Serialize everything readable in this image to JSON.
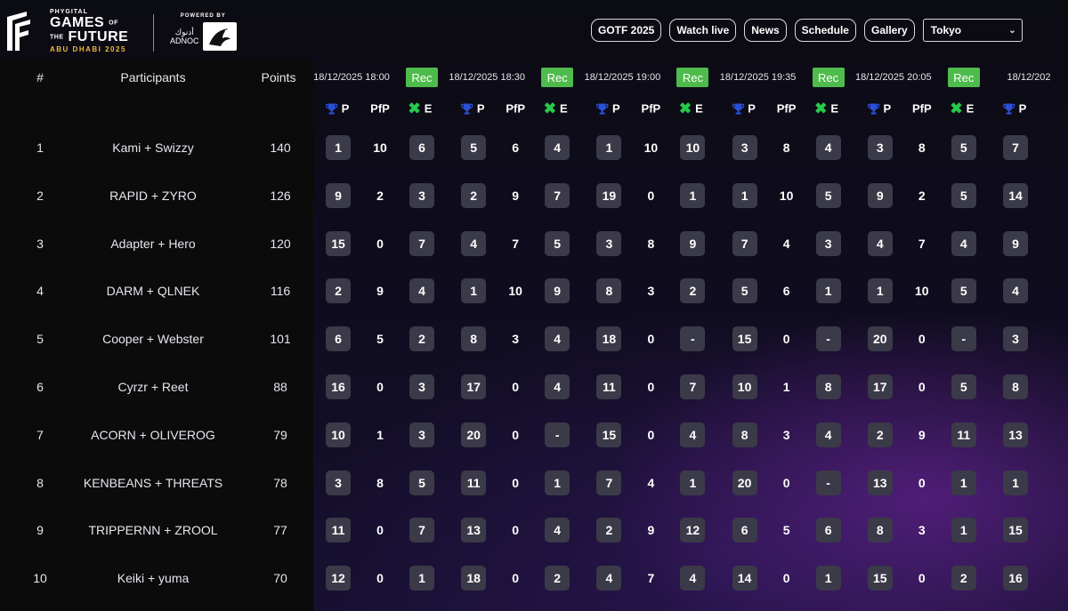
{
  "brand": {
    "phygital": "PHYGITAL",
    "games": "GAMES",
    "of": "OF",
    "the": "THE",
    "future": "FUTURE",
    "location": "ABU DHABI 2025",
    "powered_by": "POWERED BY",
    "sponsor_arabic": "أدنوك",
    "sponsor": "ADNOC"
  },
  "nav": {
    "items": [
      "GOTF 2025",
      "Watch live",
      "News",
      "Schedule",
      "Gallery"
    ],
    "timezone": "Tokyo",
    "timezone_icon": "chevron-down-icon"
  },
  "table": {
    "headers": {
      "rank": "#",
      "participants": "Participants",
      "points": "Points"
    },
    "rec_label": "Rec",
    "sub_labels": {
      "placement": "P",
      "pfp": "PfP",
      "elims": "E"
    },
    "icons": {
      "placement": "trophy-icon",
      "elims": "x-mark-icon"
    },
    "matches": [
      "18/12/2025 18:00",
      "18/12/2025 18:30",
      "18/12/2025 19:00",
      "18/12/2025 19:35",
      "18/12/2025 20:05",
      "18/12/202"
    ],
    "rows": [
      {
        "rank": "1",
        "team": "Kami + Swizzy",
        "points": "140",
        "values": [
          "1",
          "10",
          "6",
          "5",
          "6",
          "4",
          "1",
          "10",
          "10",
          "3",
          "8",
          "4",
          "3",
          "8",
          "5",
          "7"
        ]
      },
      {
        "rank": "2",
        "team": "RAPID + ZYRO",
        "points": "126",
        "values": [
          "9",
          "2",
          "3",
          "2",
          "9",
          "7",
          "19",
          "0",
          "1",
          "1",
          "10",
          "5",
          "9",
          "2",
          "5",
          "14"
        ]
      },
      {
        "rank": "3",
        "team": "Adapter + Hero",
        "points": "120",
        "values": [
          "15",
          "0",
          "7",
          "4",
          "7",
          "5",
          "3",
          "8",
          "9",
          "7",
          "4",
          "3",
          "4",
          "7",
          "4",
          "9"
        ]
      },
      {
        "rank": "4",
        "team": "DARM + QLNEK",
        "points": "116",
        "values": [
          "2",
          "9",
          "4",
          "1",
          "10",
          "9",
          "8",
          "3",
          "2",
          "5",
          "6",
          "1",
          "1",
          "10",
          "5",
          "4"
        ]
      },
      {
        "rank": "5",
        "team": "Cooper + Webster",
        "points": "101",
        "values": [
          "6",
          "5",
          "2",
          "8",
          "3",
          "4",
          "18",
          "0",
          "-",
          "15",
          "0",
          "-",
          "20",
          "0",
          "-",
          "3"
        ]
      },
      {
        "rank": "6",
        "team": "Cyrzr + Reet",
        "points": "88",
        "values": [
          "16",
          "0",
          "3",
          "17",
          "0",
          "4",
          "11",
          "0",
          "7",
          "10",
          "1",
          "8",
          "17",
          "0",
          "5",
          "8"
        ]
      },
      {
        "rank": "7",
        "team": "ACORN + OLIVEROG",
        "points": "79",
        "values": [
          "10",
          "1",
          "3",
          "20",
          "0",
          "-",
          "15",
          "0",
          "4",
          "8",
          "3",
          "4",
          "2",
          "9",
          "11",
          "13"
        ]
      },
      {
        "rank": "8",
        "team": "KENBEANS + THREATS",
        "points": "78",
        "values": [
          "3",
          "8",
          "5",
          "11",
          "0",
          "1",
          "7",
          "4",
          "1",
          "20",
          "0",
          "-",
          "13",
          "0",
          "1",
          "1"
        ]
      },
      {
        "rank": "9",
        "team": "TRIPPERNN + ZROOL",
        "points": "77",
        "values": [
          "11",
          "0",
          "7",
          "13",
          "0",
          "4",
          "2",
          "9",
          "12",
          "6",
          "5",
          "6",
          "8",
          "3",
          "1",
          "15"
        ]
      },
      {
        "rank": "10",
        "team": "Keiki + yuma",
        "points": "70",
        "values": [
          "12",
          "0",
          "1",
          "18",
          "0",
          "2",
          "4",
          "7",
          "4",
          "14",
          "0",
          "1",
          "15",
          "0",
          "2",
          "16"
        ]
      }
    ]
  },
  "colors": {
    "background": "#0c0c14",
    "rec_button": "#4fbb4c",
    "value_box": "#3b3a48",
    "elim_icon": "#28c94a",
    "trophy_icon": "#2a4fd8",
    "brand_gold": "#f0b93a"
  }
}
